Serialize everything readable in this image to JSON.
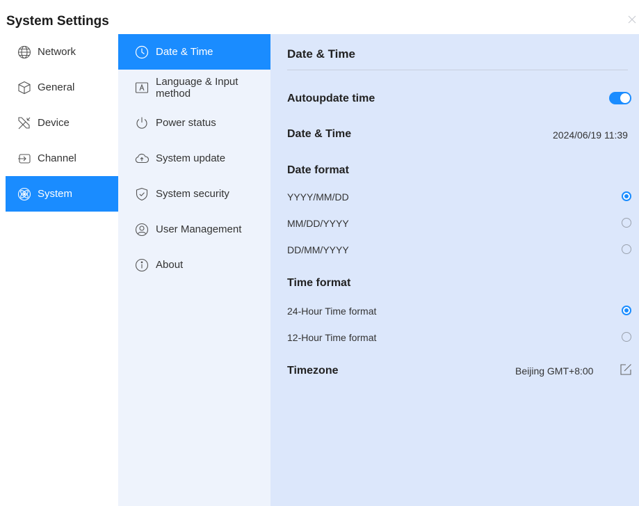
{
  "window": {
    "title": "System Settings"
  },
  "nav": {
    "items": [
      {
        "label": "Network",
        "icon": "globe-icon"
      },
      {
        "label": "General",
        "icon": "cube-icon"
      },
      {
        "label": "Device",
        "icon": "tools-icon"
      },
      {
        "label": "Channel",
        "icon": "input-source-icon"
      },
      {
        "label": "System",
        "icon": "atom-icon",
        "active": true
      }
    ]
  },
  "subnav": {
    "items": [
      {
        "label": "Date & Time",
        "icon": "clock-icon",
        "active": true
      },
      {
        "label": "Language & Input method",
        "icon": "keyboard-a-icon"
      },
      {
        "label": "Power status",
        "icon": "power-icon"
      },
      {
        "label": "System update",
        "icon": "cloud-upload-icon"
      },
      {
        "label": "System security",
        "icon": "shield-check-icon"
      },
      {
        "label": "User Management",
        "icon": "user-icon"
      },
      {
        "label": "About",
        "icon": "info-icon"
      }
    ]
  },
  "content": {
    "section_title": "Date & Time",
    "autoupdate": {
      "label": "Autoupdate time",
      "enabled": true
    },
    "datetime": {
      "label": "Date & Time",
      "value": "2024/06/19 11:39"
    },
    "date_format": {
      "label": "Date format",
      "options": [
        {
          "label": "YYYY/MM/DD",
          "selected": true
        },
        {
          "label": "MM/DD/YYYY",
          "selected": false
        },
        {
          "label": "DD/MM/YYYY",
          "selected": false
        }
      ]
    },
    "time_format": {
      "label": "Time format",
      "options": [
        {
          "label": "24-Hour Time format",
          "selected": true
        },
        {
          "label": "12-Hour Time format",
          "selected": false
        }
      ]
    },
    "timezone": {
      "label": "Timezone",
      "value": "Beijing GMT+8:00"
    }
  },
  "colors": {
    "accent": "#1a8cff",
    "subnav_bg": "#eef3fc",
    "content_bg": "#dce7fb"
  }
}
